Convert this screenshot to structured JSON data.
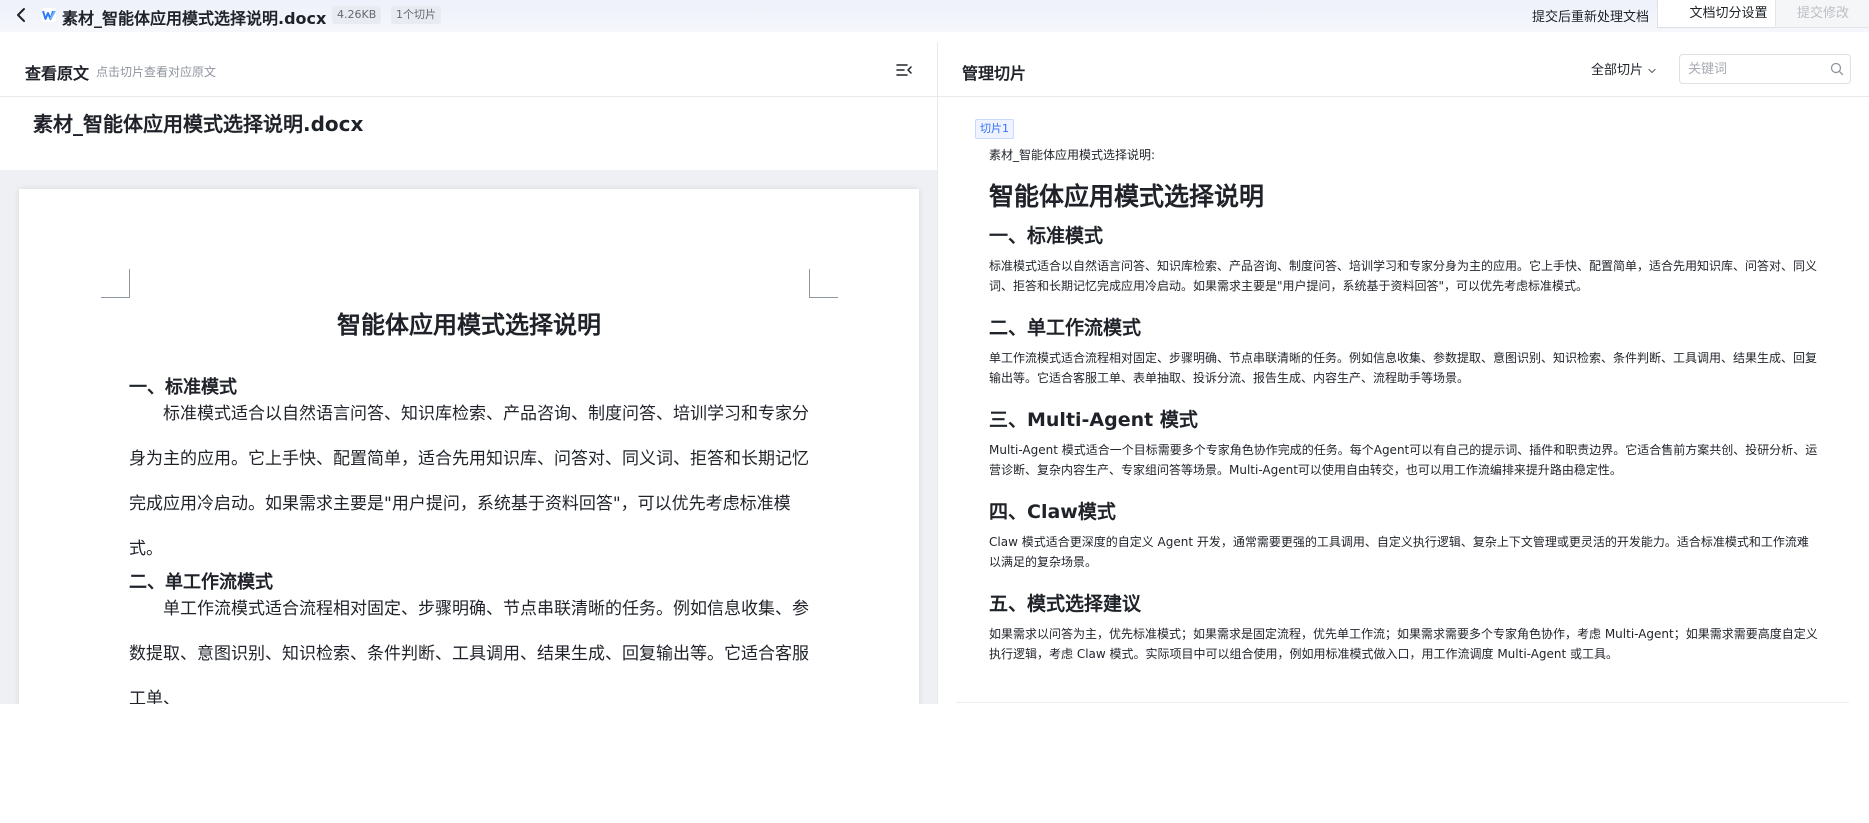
{
  "topbar": {
    "file_name": "素材_智能体应用模式选择说明.docx",
    "file_size": "4.26KB",
    "chunk_count": "1个切片",
    "reprocess_label": "提交后重新处理文档",
    "chunk_settings_label": "文档切分设置",
    "submit_label": "提交修改"
  },
  "left": {
    "title": "查看原文",
    "hint": "点击切片查看对应原文",
    "doc_title": "素材_智能体应用模式选择说明.docx",
    "page": {
      "h1": "智能体应用模式选择说明",
      "s1_heading": "一、标准模式",
      "s1_body": "标准模式适合以自然语言问答、知识库检索、产品咨询、制度问答、培训学习和专家分身为主的应用。它上手快、配置简单，适合先用知识库、问答对、同义词、拒答和长期记忆完成应用冷启动。如果需求主要是\"用户提问，系统基于资料回答\"，可以优先考虑标准模式。",
      "s2_heading": "二、单工作流模式",
      "s2_body": "单工作流模式适合流程相对固定、步骤明确、节点串联清晰的任务。例如信息收集、参数提取、意图识别、知识检索、条件判断、工具调用、结果生成、回复输出等。它适合客服工单、"
    }
  },
  "right": {
    "title": "管理切片",
    "filter_label": "全部切片",
    "search_placeholder": "关键词",
    "chunk": {
      "badge": "切片1",
      "lead": "素材_智能体应用模式选择说明:",
      "h1": "智能体应用模式选择说明",
      "sections": [
        {
          "heading": "一、标准模式",
          "body": "标准模式适合以自然语言问答、知识库检索、产品咨询、制度问答、培训学习和专家分身为主的应用。它上手快、配置简单，适合先用知识库、问答对、同义词、拒答和长期记忆完成应用冷启动。如果需求主要是\"用户提问，系统基于资料回答\"，可以优先考虑标准模式。"
        },
        {
          "heading": "二、单工作流模式",
          "body": "单工作流模式适合流程相对固定、步骤明确、节点串联清晰的任务。例如信息收集、参数提取、意图识别、知识检索、条件判断、工具调用、结果生成、回复输出等。它适合客服工单、表单抽取、投诉分流、报告生成、内容生产、流程助手等场景。"
        },
        {
          "heading": "三、Multi-Agent 模式",
          "body": "Multi-Agent 模式适合一个目标需要多个专家角色协作完成的任务。每个Agent可以有自己的提示词、插件和职责边界。它适合售前方案共创、投研分析、运营诊断、复杂内容生产、专家组问答等场景。Multi-Agent可以使用自由转交，也可以用工作流编排来提升路由稳定性。"
        },
        {
          "heading": "四、Claw模式",
          "body": "Claw 模式适合更深度的自定义 Agent 开发，通常需要更强的工具调用、自定义执行逻辑、复杂上下文管理或更灵活的开发能力。适合标准模式和工作流难以满足的复杂场景。"
        },
        {
          "heading": "五、模式选择建议",
          "body": "如果需求以问答为主，优先标准模式；如果需求是固定流程，优先单工作流；如果需求需要多个专家角色协作，考虑 Multi-Agent；如果需求需要高度自定义执行逻辑，考虑 Claw 模式。实际项目中可以组合使用，例如用标准模式做入口，用工作流调度 Multi-Agent 或工具。"
        }
      ]
    }
  },
  "colors": {
    "accent": "#3370ff",
    "topbar_bg": "#eef1fb",
    "page_area_bg": "#eef0f4",
    "muted_text": "#8f959e"
  }
}
